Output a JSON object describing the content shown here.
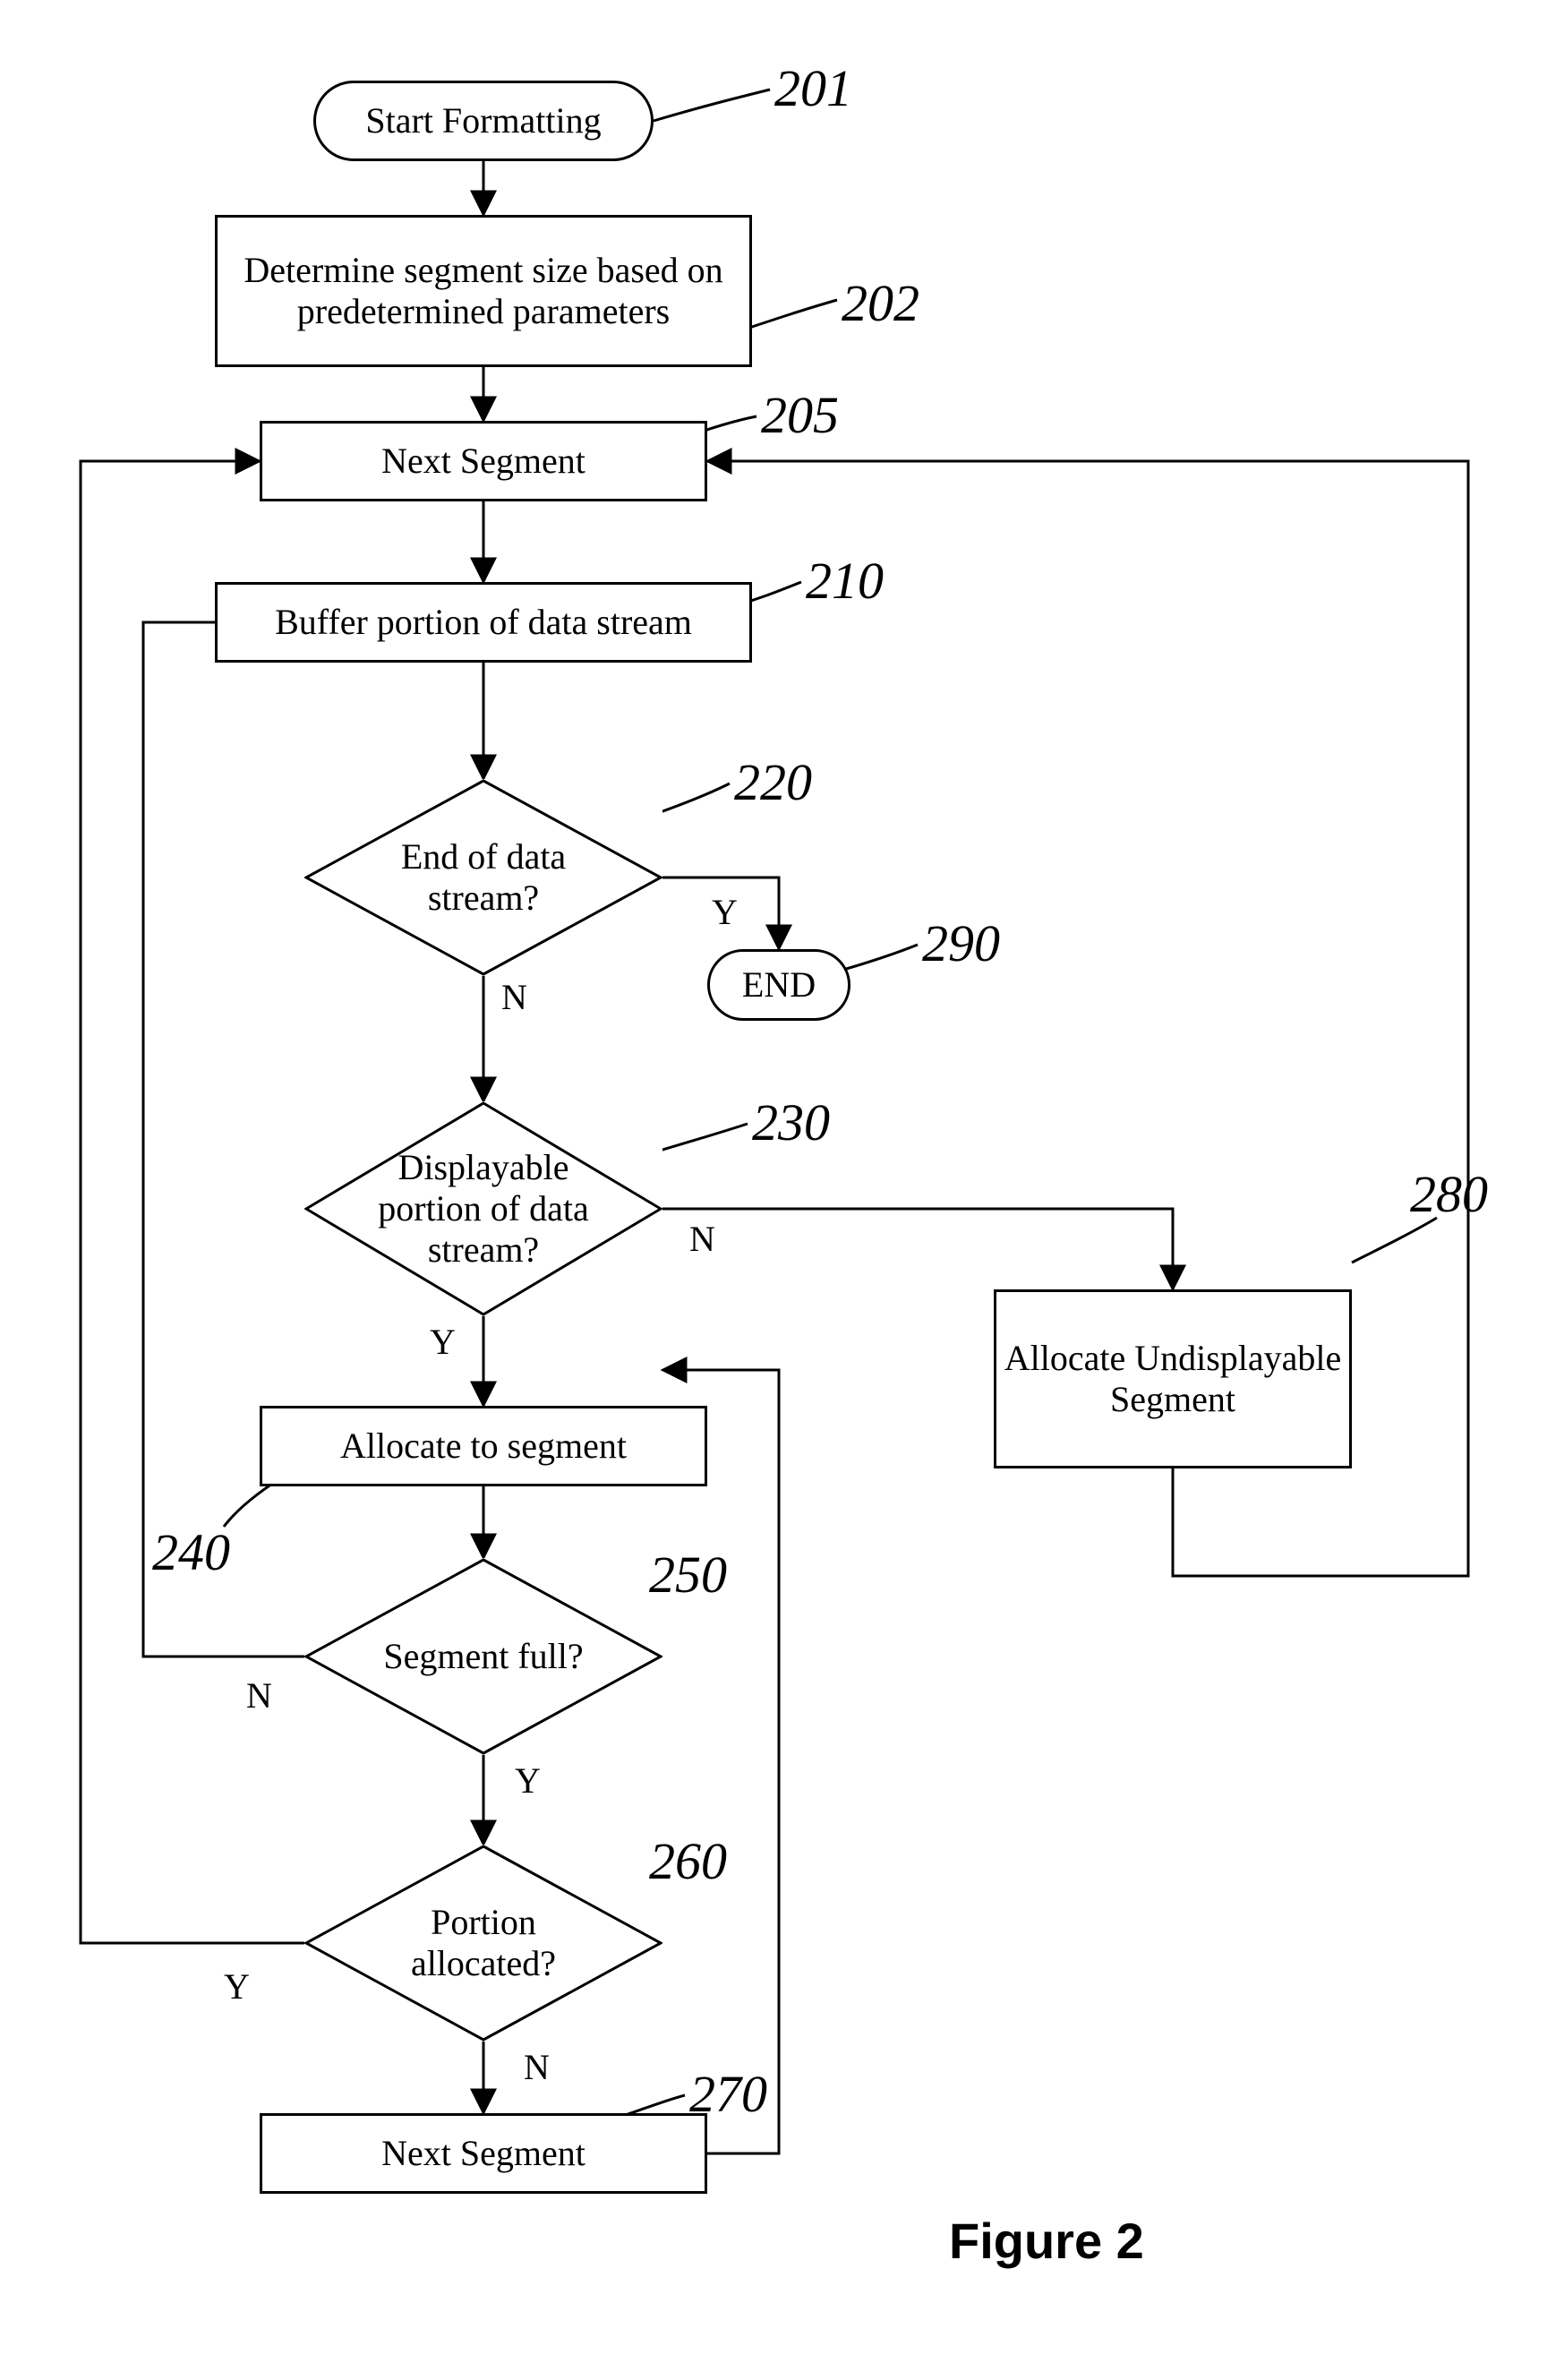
{
  "nodes": {
    "n201": {
      "text": "Start Formatting",
      "ref": "201"
    },
    "n202": {
      "text": "Determine segment size based on predetermined parameters",
      "ref": "202"
    },
    "n205": {
      "text": "Next Segment",
      "ref": "205"
    },
    "n210": {
      "text": "Buffer portion of data stream",
      "ref": "210"
    },
    "n220": {
      "text": "End of data stream?",
      "ref": "220"
    },
    "n230": {
      "text": "Displayable portion of data stream?",
      "ref": "230"
    },
    "n240": {
      "text": "Allocate to segment",
      "ref": "240"
    },
    "n250": {
      "text": "Segment full?",
      "ref": "250"
    },
    "n260": {
      "text": "Portion allocated?",
      "ref": "260"
    },
    "n270": {
      "text": "Next Segment",
      "ref": "270"
    },
    "n280": {
      "text": "Allocate Undisplayable Segment",
      "ref": "280"
    },
    "n290": {
      "text": "END",
      "ref": "290"
    }
  },
  "edgeLabels": {
    "e220y": "Y",
    "e220n": "N",
    "e230y": "Y",
    "e230n": "N",
    "e250y": "Y",
    "e250n": "N",
    "e260y": "Y",
    "e260n": "N"
  },
  "caption": "Figure 2"
}
